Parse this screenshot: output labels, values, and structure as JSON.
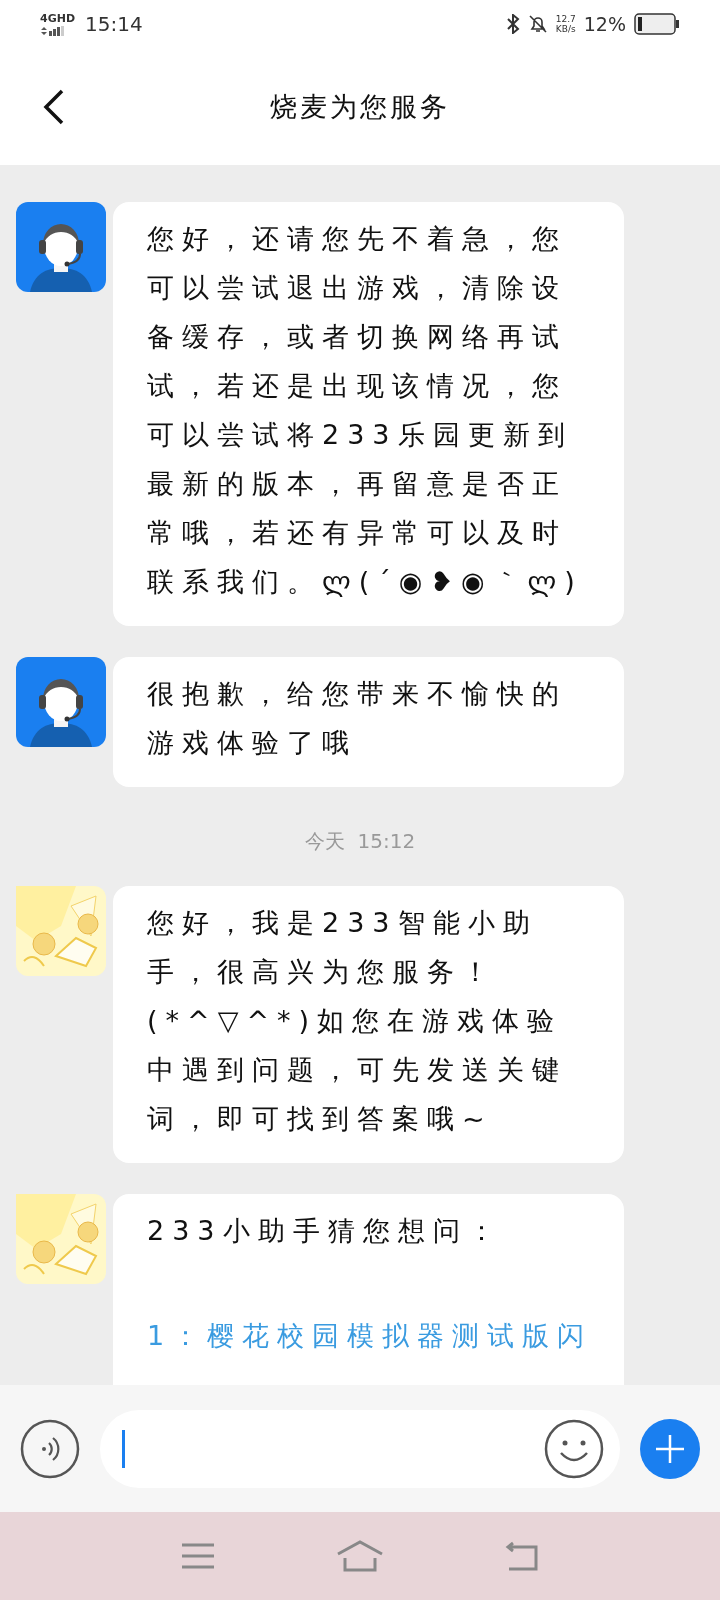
{
  "status_bar": {
    "network": "4GHD",
    "time": "15:14",
    "speed": "12.7",
    "speed_unit": "KB/s",
    "battery": "12%"
  },
  "header": {
    "title": "烧麦为您服务"
  },
  "messages": [
    {
      "kind": "text",
      "avatar": {
        "kind": "agent"
      },
      "text": "您好，还请您先不着急，您可以尝试退出游戏，清除设备缓存，或者切换网络再试试，若还是出现该情况，您可以尝试将233乐园更新到最新的版本，再留意是否正常哦，若还有异常可以及时联系我们。ლ(´◉❥◉｀ლ)"
    },
    {
      "kind": "text",
      "avatar": {
        "kind": "agent"
      },
      "text": "很抱歉，给您带来不愉快的游戏体验了哦"
    },
    {
      "kind": "timestamp",
      "text": "今天  15:12"
    },
    {
      "kind": "text",
      "avatar": {
        "kind": "bot"
      },
      "text": "您好，我是233智能小助手，很高兴为您服务！(*^▽^*)如您在游戏体验中遇到问题，可先发送关键词，即可找到答案哦~"
    },
    {
      "kind": "suggestions",
      "avatar": {
        "kind": "bot"
      },
      "text": "233小助手猜您想问：",
      "links": [
        "1：樱花校园模拟器测试版闪"
      ]
    }
  ]
}
